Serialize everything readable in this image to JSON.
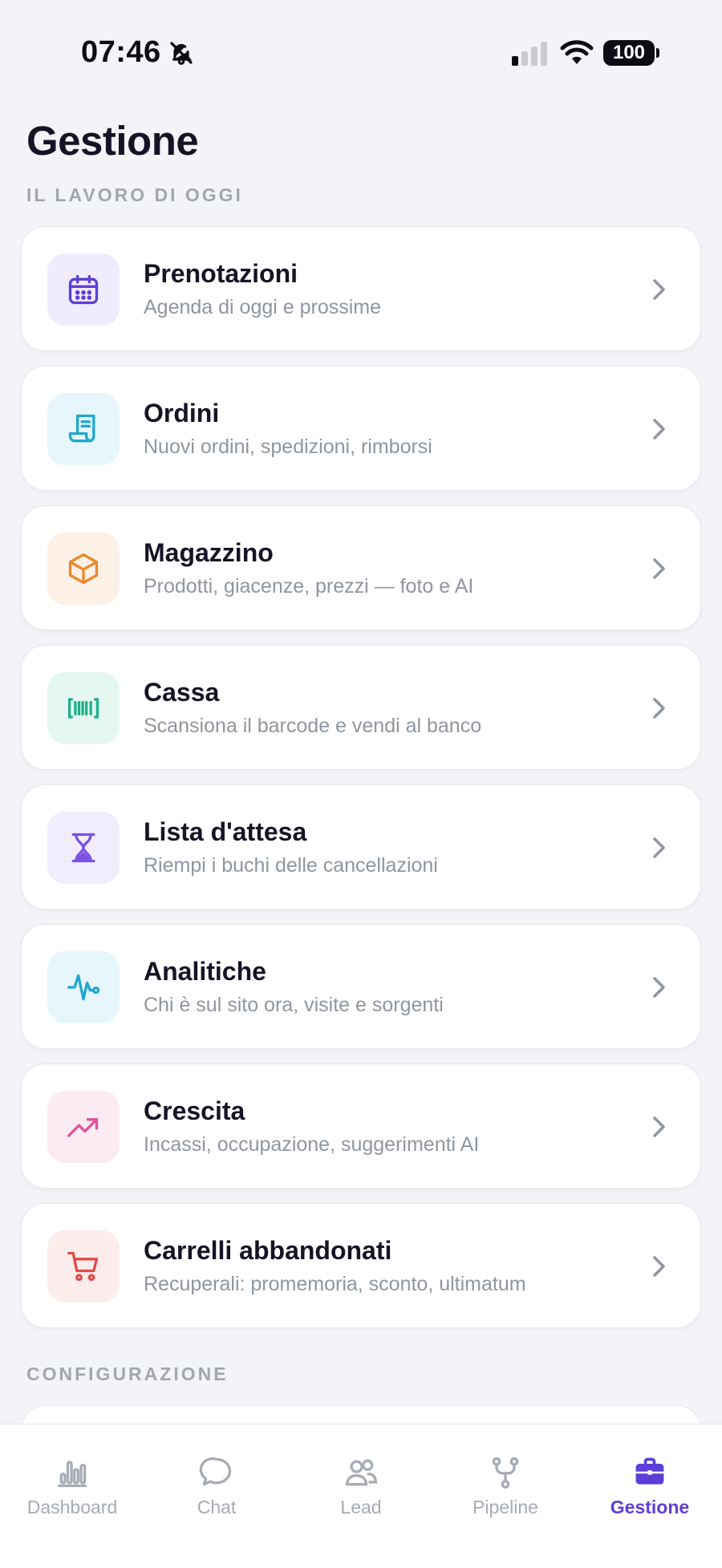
{
  "status_bar": {
    "time": "07:46",
    "battery": "100",
    "icons": [
      "bell-off-icon",
      "signal-icon",
      "wifi-icon",
      "battery-icon"
    ]
  },
  "header": {
    "title": "Gestione"
  },
  "sections": {
    "today": "IL LAVORO DI OGGI",
    "config": "CONFIGURAZIONE"
  },
  "cards": [
    {
      "title": "Prenotazioni",
      "subtitle": "Agenda di oggi e prossime",
      "icon": "calendar-icon",
      "color": "#5b3fd6",
      "bg": "#efedfd"
    },
    {
      "title": "Ordini",
      "subtitle": "Nuovi ordini, spedizioni, rimborsi",
      "icon": "receipt-icon",
      "color": "#22a6cf",
      "bg": "#e6f6fc"
    },
    {
      "title": "Magazzino",
      "subtitle": "Prodotti, giacenze, prezzi — foto e AI",
      "icon": "box-icon",
      "color": "#e98a2c",
      "bg": "#fdf0e6"
    },
    {
      "title": "Cassa",
      "subtitle": "Scansiona il barcode e vendi al banco",
      "icon": "barcode-icon",
      "color": "#1eb08a",
      "bg": "#e5f7f1"
    },
    {
      "title": "Lista d'attesa",
      "subtitle": "Riempi i buchi delle cancellazioni",
      "icon": "hourglass-icon",
      "color": "#7a52e6",
      "bg": "#f1edfd"
    },
    {
      "title": "Analitiche",
      "subtitle": "Chi è sul sito ora, visite e sorgenti",
      "icon": "pulse-icon",
      "color": "#22a6cf",
      "bg": "#e6f6fc"
    },
    {
      "title": "Crescita",
      "subtitle": "Incassi, occupazione, suggerimenti AI",
      "icon": "trend-up-icon",
      "color": "#e0529c",
      "bg": "#fdebf3"
    },
    {
      "title": "Carrelli abbandonati",
      "subtitle": "Recuperali: promemoria, sconto, ultimatum",
      "icon": "cart-icon",
      "color": "#e24a4a",
      "bg": "#fdecec"
    }
  ],
  "tabs": [
    {
      "label": "Dashboard",
      "icon": "bar-chart-icon",
      "active": false
    },
    {
      "label": "Chat",
      "icon": "chat-bubble-icon",
      "active": false
    },
    {
      "label": "Lead",
      "icon": "users-icon",
      "active": false
    },
    {
      "label": "Pipeline",
      "icon": "fork-icon",
      "active": false
    },
    {
      "label": "Gestione",
      "icon": "briefcase-icon",
      "active": true
    }
  ],
  "colors": {
    "accent": "#5b3fd6",
    "inactive_tab": "#a7abb5",
    "background": "#f3f4f7"
  }
}
